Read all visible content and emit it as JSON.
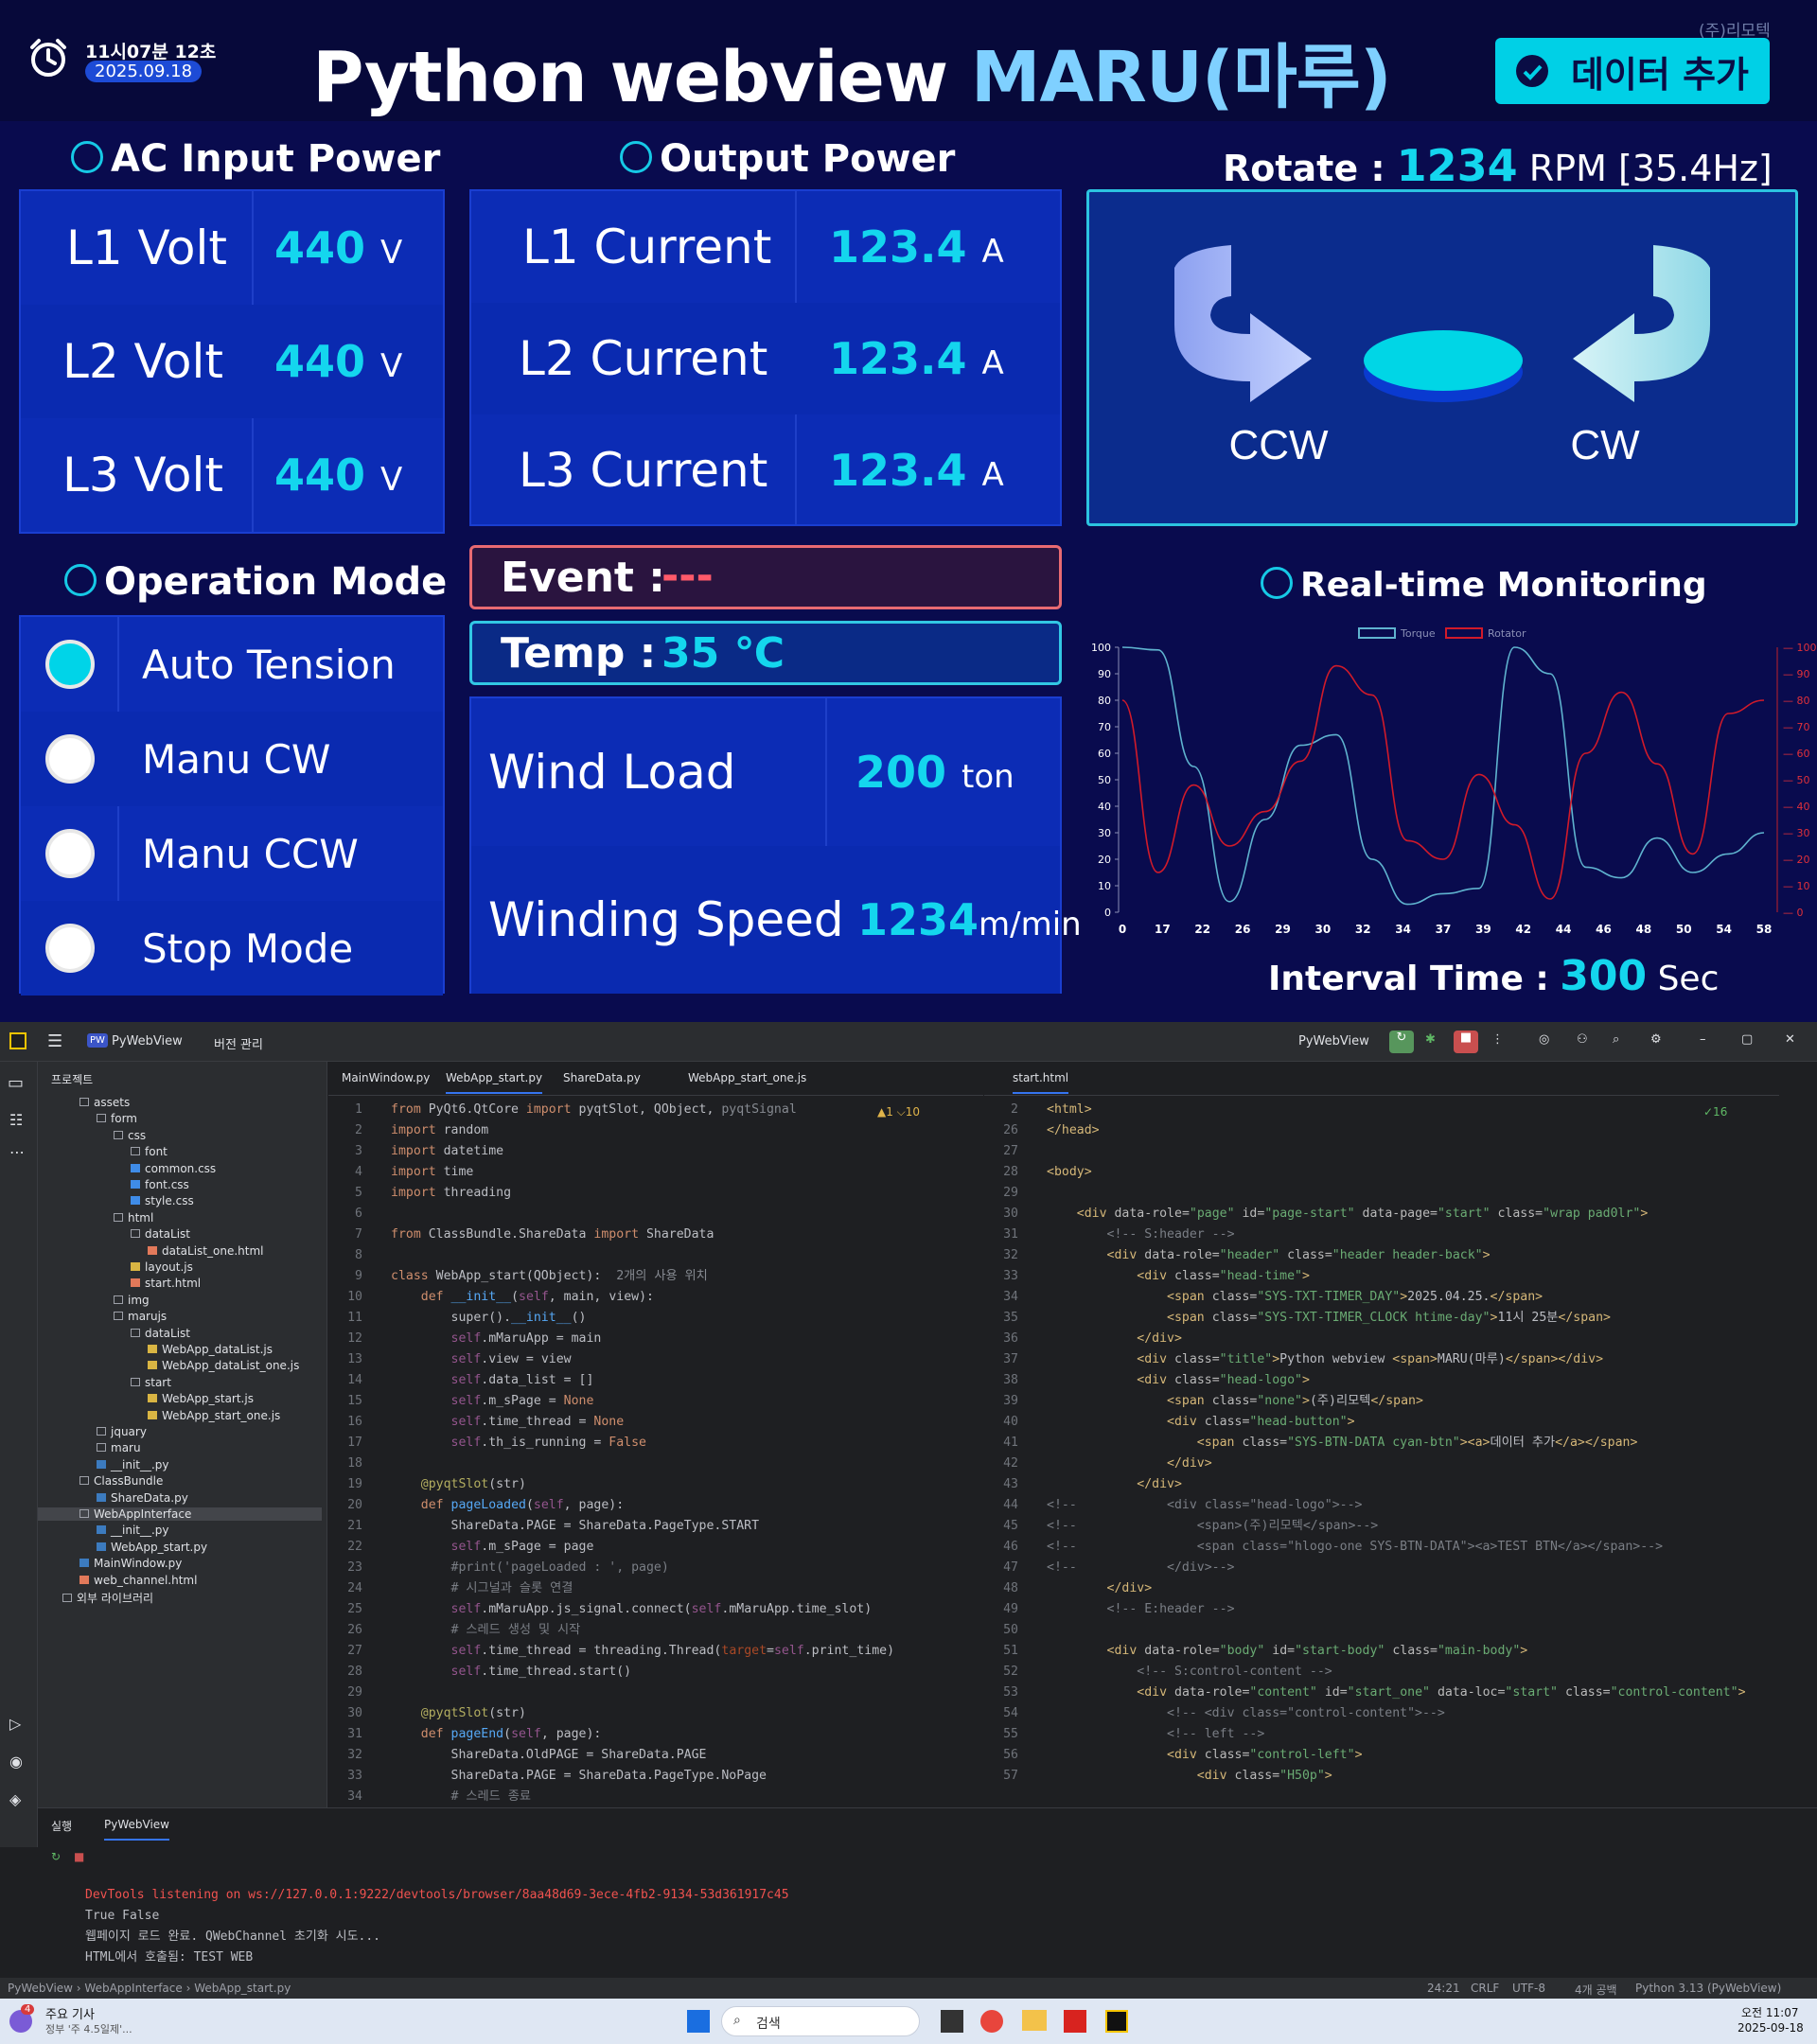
{
  "header": {
    "time": "11시07분 12초",
    "date": "2025.09.18",
    "title_main": "Python webview ",
    "title_accent": "MARU(마루)",
    "company": "(주)리모텍",
    "add_button": "데이터 추가"
  },
  "ac_input": {
    "title": "AC Input Power",
    "rows": [
      {
        "label": "L1 Volt",
        "value": "440",
        "unit": "V"
      },
      {
        "label": "L2 Volt",
        "value": "440",
        "unit": "V"
      },
      {
        "label": "L3 Volt",
        "value": "440",
        "unit": "V"
      }
    ]
  },
  "output": {
    "title": "Output Power",
    "rows": [
      {
        "label": "L1 Current",
        "value": "123.4",
        "unit": "A"
      },
      {
        "label": "L2 Current",
        "value": "123.4",
        "unit": "A"
      },
      {
        "label": "L3 Current",
        "value": "123.4",
        "unit": "A"
      }
    ]
  },
  "rotate": {
    "label": "Rotate :",
    "value": "1234",
    "unit": "RPM [35.4Hz]",
    "ccw": "CCW",
    "cw": "CW"
  },
  "operation": {
    "title": "Operation Mode",
    "modes": [
      {
        "label": "Auto Tension",
        "selected": true
      },
      {
        "label": "Manu CW",
        "selected": false
      },
      {
        "label": "Manu CCW",
        "selected": false
      },
      {
        "label": "Stop Mode",
        "selected": false
      }
    ]
  },
  "event": {
    "label": "Event :",
    "value": "---"
  },
  "temp": {
    "label": "Temp :",
    "value": "35",
    "unit": "℃"
  },
  "load": {
    "wind_label": "Wind Load",
    "wind_value": "200",
    "wind_unit": "ton",
    "speed_label": "Winding Speed",
    "speed_value": "1234",
    "speed_unit": "m/min"
  },
  "monitoring": {
    "title": "Real-time Monitoring",
    "interval_label": "Interval Time :",
    "interval_value": "300",
    "interval_unit": "Sec"
  },
  "chart_data": {
    "type": "line",
    "x": [
      "0",
      "17",
      "22",
      "26",
      "29",
      "30",
      "32",
      "34",
      "37",
      "39",
      "42",
      "44",
      "46",
      "48",
      "50",
      "54",
      "58"
    ],
    "series": [
      {
        "name": "Torque",
        "color": "#5fb3cf",
        "values": [
          100,
          99,
          55,
          4,
          35,
          63,
          67,
          20,
          3,
          7,
          9,
          100,
          90,
          17,
          13,
          28,
          15,
          22,
          30
        ]
      },
      {
        "name": "Rotator",
        "color": "#d11a2a",
        "values": [
          80,
          15,
          48,
          25,
          38,
          57,
          93,
          82,
          27,
          20,
          52,
          33,
          5,
          60,
          83,
          56,
          22,
          75,
          80
        ]
      }
    ],
    "ylim": [
      0,
      100
    ],
    "yticks": [
      "0",
      "10",
      "20",
      "30",
      "40",
      "50",
      "60",
      "70",
      "80",
      "90",
      "100"
    ],
    "legend": "top-center",
    "grid": false
  },
  "ide": {
    "project": "PyWebView",
    "vcs": "버전 관리",
    "run_config": "PyWebView",
    "panel_title": "프로젝트",
    "tree": [
      {
        "label": "assets",
        "depth": 0,
        "kind": "folder"
      },
      {
        "label": "form",
        "depth": 1,
        "kind": "folder"
      },
      {
        "label": "css",
        "depth": 2,
        "kind": "folder"
      },
      {
        "label": "font",
        "depth": 3,
        "kind": "folder"
      },
      {
        "label": "common.css",
        "depth": 3,
        "kind": "css"
      },
      {
        "label": "font.css",
        "depth": 3,
        "kind": "css"
      },
      {
        "label": "style.css",
        "depth": 3,
        "kind": "css"
      },
      {
        "label": "html",
        "depth": 2,
        "kind": "folder"
      },
      {
        "label": "dataList",
        "depth": 3,
        "kind": "folder"
      },
      {
        "label": "dataList_one.html",
        "depth": 4,
        "kind": "html"
      },
      {
        "label": "layout.js",
        "depth": 3,
        "kind": "js"
      },
      {
        "label": "start.html",
        "depth": 3,
        "kind": "html"
      },
      {
        "label": "img",
        "depth": 2,
        "kind": "folder"
      },
      {
        "label": "marujs",
        "depth": 2,
        "kind": "folder"
      },
      {
        "label": "dataList",
        "depth": 3,
        "kind": "folder"
      },
      {
        "label": "WebApp_dataList.js",
        "depth": 4,
        "kind": "js"
      },
      {
        "label": "WebApp_dataList_one.js",
        "depth": 4,
        "kind": "js"
      },
      {
        "label": "start",
        "depth": 3,
        "kind": "folder"
      },
      {
        "label": "WebApp_start.js",
        "depth": 4,
        "kind": "js"
      },
      {
        "label": "WebApp_start_one.js",
        "depth": 4,
        "kind": "js"
      },
      {
        "label": "jquary",
        "depth": 1,
        "kind": "folder"
      },
      {
        "label": "maru",
        "depth": 1,
        "kind": "folder"
      },
      {
        "label": "__init__.py",
        "depth": 1,
        "kind": "py"
      },
      {
        "label": "ClassBundle",
        "depth": 0,
        "kind": "folder"
      },
      {
        "label": "ShareData.py",
        "depth": 1,
        "kind": "py"
      },
      {
        "label": "WebAppInterface",
        "depth": 0,
        "kind": "folder",
        "selected": true
      },
      {
        "label": "__init__.py",
        "depth": 1,
        "kind": "py"
      },
      {
        "label": "WebApp_start.py",
        "depth": 1,
        "kind": "py"
      },
      {
        "label": "MainWindow.py",
        "depth": 0,
        "kind": "py"
      },
      {
        "label": "web_channel.html",
        "depth": 0,
        "kind": "html"
      },
      {
        "label": "외부 라이브러리",
        "depth": -1,
        "kind": "lib"
      }
    ],
    "tabs_left": [
      "MainWindow.py",
      "WebApp_start.py",
      "ShareData.py",
      "WebApp_start_one.js"
    ],
    "tabs_right": [
      "start.html"
    ],
    "inspect_left": "▲1  ⌵10",
    "inspect_right": "✓16",
    "run_tab_label": "실행",
    "run_tab": "PyWebView",
    "console": [
      "DevTools listening on ws://127.0.0.1:9222/devtools/browser/8aa48d69-3ece-4fb2-9134-53d361917c45",
      "True False",
      "웹페이지 로드 완료. QWebChannel 초기화 시도...",
      "HTML에서 호출됨: TEST WEB"
    ],
    "status_left": [
      "PyWebView",
      "WebAppInterface",
      "WebApp_start.py"
    ],
    "status_right": [
      "24:21",
      "CRLF",
      "UTF-8",
      "4개 공백",
      "Python 3.13 (PyWebView)"
    ]
  },
  "taskbar": {
    "news_title": "주요 기사",
    "news_sub": "정부 '주 4.5일제'...",
    "search": "검색",
    "clock_time": "오전 11:07",
    "clock_date": "2025-09-18",
    "badge": "4"
  }
}
